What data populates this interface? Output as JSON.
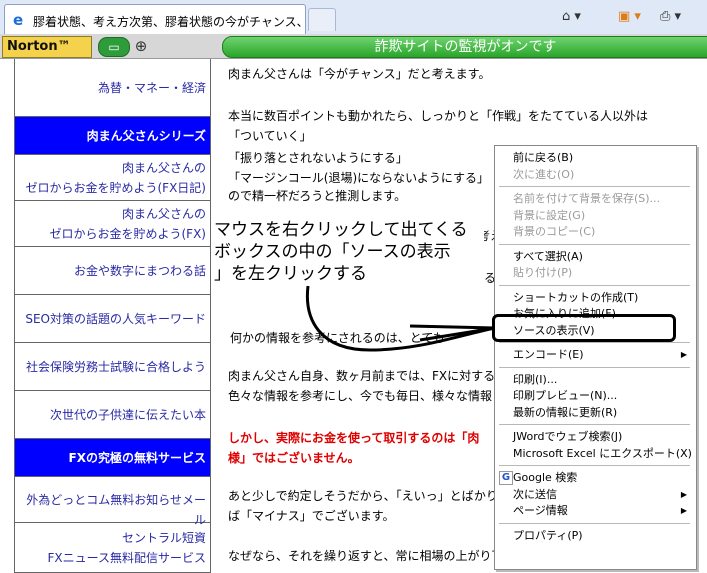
{
  "browser": {
    "tab_title": "膠着状態、考え方次第、膠着状態の今がチャンス、ゼロ...",
    "tab_icon": "ie-icon",
    "new_tab_icon": "new-tab-icon"
  },
  "norton": {
    "logo": "Norton™",
    "status": "詐欺サイトの監視がオンです"
  },
  "sidebar": {
    "items": [
      {
        "lines": [
          "為替・マネー・経済"
        ],
        "style": "link"
      },
      {
        "lines": [
          "肉まん父さんシリーズ"
        ],
        "style": "header"
      },
      {
        "lines": [
          "肉まん父さんの",
          "ゼロからお金を貯めよう(FX日記)"
        ],
        "style": "link"
      },
      {
        "lines": [
          "肉まん父さんの",
          "ゼロからお金を貯めよう(FX)"
        ],
        "style": "link"
      },
      {
        "lines": [
          "お金や数字にまつわる話"
        ],
        "style": "link"
      },
      {
        "lines": [
          "SEO対策の話題の人気キーワード"
        ],
        "style": "link"
      },
      {
        "lines": [
          "社会保険労務士試験に合格しよう"
        ],
        "style": "link"
      },
      {
        "lines": [
          "次世代の子供達に伝えたい本"
        ],
        "style": "link"
      },
      {
        "lines": [
          "FXの究極の無料サービス"
        ],
        "style": "header"
      },
      {
        "lines": [
          "外為どっとコム無料お知らせメール"
        ],
        "style": "link"
      },
      {
        "lines": [
          "セントラル短資",
          "FXニュース無料配信サービス"
        ],
        "style": "link"
      }
    ]
  },
  "content": {
    "lines": [
      "肉まん父さんは「今がチャンス」だと考えます。",
      "本当に数百ポイントも動かれたら、しっかりと「作戦」をたてている人以外は",
      "「ついていく」",
      "「振り落とされないようにする」",
      "「マージンコール(退場)にならないようにする」",
      "ので精一杯だろうと推測します。",
      "を考え",
      "いるよう",
      "何かの情報を参考にされるのは、とても",
      "肉まん父さん自身、数ヶ月前までは、FXに対する",
      "色々な情報を参考にし、今でも毎日、様々な情報",
      "しかし、実際にお金を使って取引するのは「肉",
      "様」ではございません。",
      "あと少しで約定しそうだから、「えいっ」とばかりに",
      "ば「マイナス」でございます。",
      "なぜなら、それを繰り返すと、常に相場の上がり下がりに気を取られて、他のことがお"
    ]
  },
  "annotation": {
    "lines": [
      "マウスを右クリックして出てくる",
      "ボックスの中の「ソースの表示",
      "」を左クリックする"
    ]
  },
  "context_menu": {
    "items": [
      {
        "label": "前に戻る(B)",
        "disabled": false,
        "sep_before": false
      },
      {
        "label": "次に進む(O)",
        "disabled": true,
        "sep_before": false
      },
      {
        "label": "名前を付けて背景を保存(S)...",
        "disabled": true,
        "sep_before": true
      },
      {
        "label": "背景に設定(G)",
        "disabled": true,
        "sep_before": false
      },
      {
        "label": "背景のコピー(C)",
        "disabled": true,
        "sep_before": false
      },
      {
        "label": "すべて選択(A)",
        "disabled": false,
        "sep_before": true
      },
      {
        "label": "貼り付け(P)",
        "disabled": true,
        "sep_before": false
      },
      {
        "label": "ショートカットの作成(T)",
        "disabled": false,
        "sep_before": true
      },
      {
        "label": "お気に入りに追加(F)...",
        "disabled": false,
        "sep_before": false
      },
      {
        "label": "ソースの表示(V)",
        "disabled": false,
        "sep_before": false
      },
      {
        "label": "エンコード(E)",
        "disabled": false,
        "sep_before": true,
        "submenu": true
      },
      {
        "label": "印刷(I)...",
        "disabled": false,
        "sep_before": true
      },
      {
        "label": "印刷プレビュー(N)...",
        "disabled": false,
        "sep_before": false
      },
      {
        "label": "最新の情報に更新(R)",
        "disabled": false,
        "sep_before": false
      },
      {
        "label": "JWordでウェブ検索(J)",
        "disabled": false,
        "sep_before": true
      },
      {
        "label": "Microsoft Excel にエクスポート(X)",
        "disabled": false,
        "sep_before": false
      },
      {
        "label": "Google 検索",
        "disabled": false,
        "sep_before": true,
        "icon": "google-icon"
      },
      {
        "label": "次に送信",
        "disabled": false,
        "sep_before": false,
        "submenu": true
      },
      {
        "label": "ページ情報",
        "disabled": false,
        "sep_before": false,
        "submenu": true
      },
      {
        "label": "プロパティ(P)",
        "disabled": false,
        "sep_before": true
      }
    ]
  }
}
